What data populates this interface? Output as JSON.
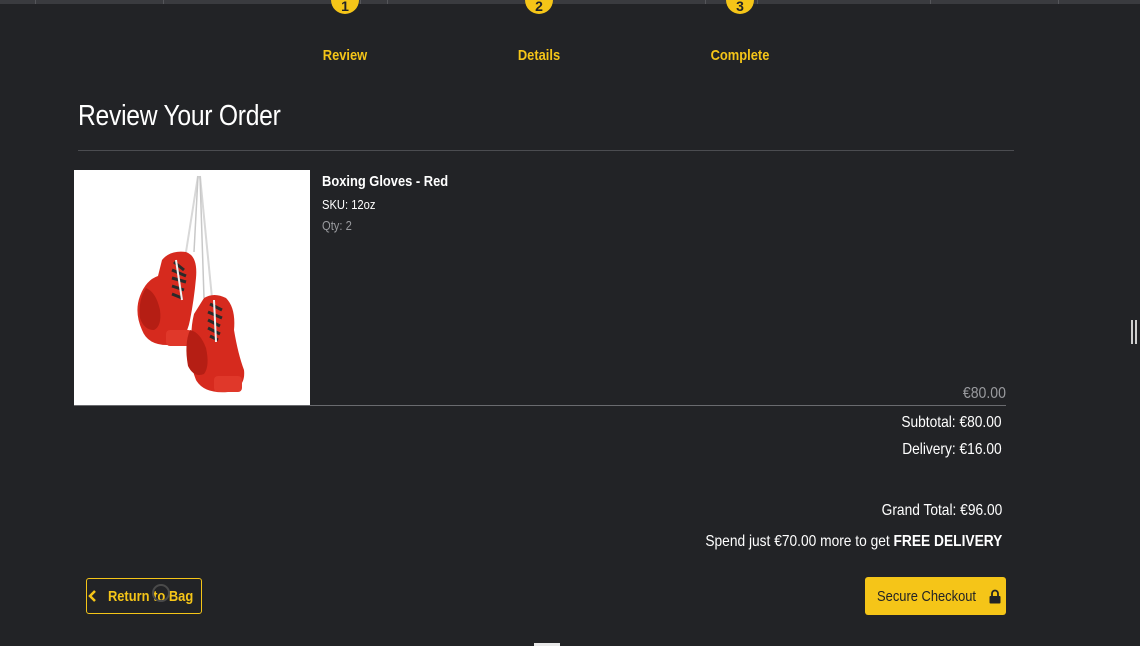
{
  "steps": [
    {
      "number": "1",
      "label": "Review"
    },
    {
      "number": "2",
      "label": "Details"
    },
    {
      "number": "3",
      "label": "Complete"
    }
  ],
  "page_title": "Review Your Order",
  "product": {
    "name": "Boxing Gloves - Red",
    "sku": "SKU: 12oz",
    "qty": "Qty: 2",
    "price": "€80.00"
  },
  "summary": {
    "subtotal": "Subtotal: €80.00",
    "delivery": "Delivery: €16.00",
    "grand_total": "Grand Total: €96.00",
    "free_delivery_prefix": "Spend just €70.00 more to get ",
    "free_delivery_emphasis": "FREE DELIVERY"
  },
  "buttons": {
    "return_label": "Return to Bag",
    "checkout_label": "Secure Checkout"
  },
  "colors": {
    "background": "#222326",
    "accent": "#f5c518"
  },
  "icons": {
    "return": "chevron-left-icon",
    "checkout": "lock-icon"
  }
}
